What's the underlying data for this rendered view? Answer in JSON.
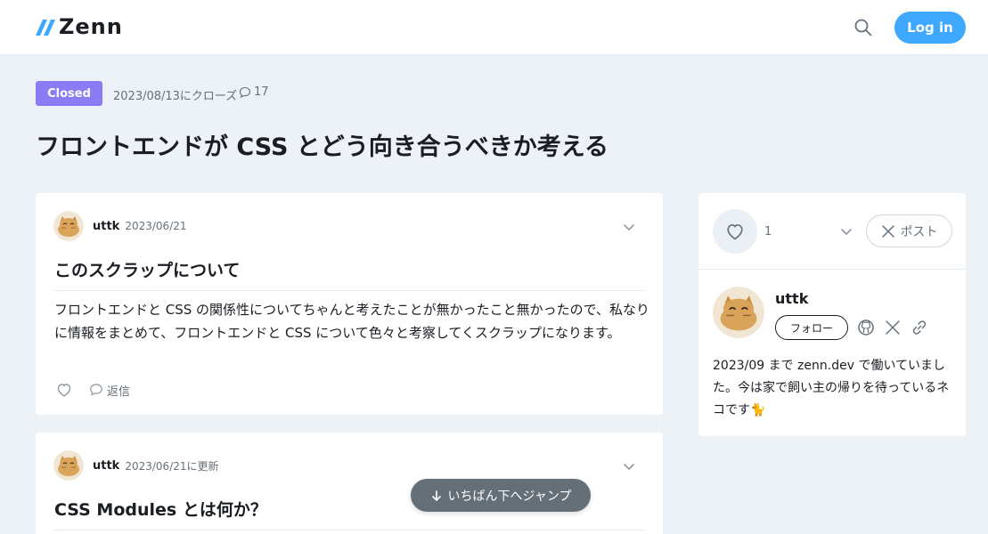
{
  "header": {
    "logo_text": "Zenn",
    "login_label": "Log in"
  },
  "scrap": {
    "status_badge": "Closed",
    "closed_date": "2023/08/13にクローズ",
    "comment_count": "17",
    "title": "フロントエンドが CSS とどう向き合うべきか考える"
  },
  "comments": [
    {
      "author": "uttk",
      "date": "2023/06/21",
      "heading": "このスクラップについて",
      "body": "フロントエンドと CSS の関係性についてちゃんと考えたことが無かったこと無かったので、私なりに情報をまとめて、フロントエンドと CSS について色々と考察してくスクラップになります。",
      "reply_label": "返信"
    },
    {
      "author": "uttk",
      "date": "2023/06/21に更新",
      "heading": "CSS Modules とは何か？"
    }
  ],
  "jump_label": "いちばん下へジャンプ",
  "sidebar": {
    "like_count": "1",
    "post_label": "ポスト",
    "author_name": "uttk",
    "follow_label": "フォロー",
    "bio": "2023/09 まで zenn.dev で働いていました。今は家で飼い主の帰りを待っているネコです🐈"
  },
  "colors": {
    "accent": "#3ea8ff",
    "badge": "#8b7cf6",
    "background": "#edf2f7"
  }
}
